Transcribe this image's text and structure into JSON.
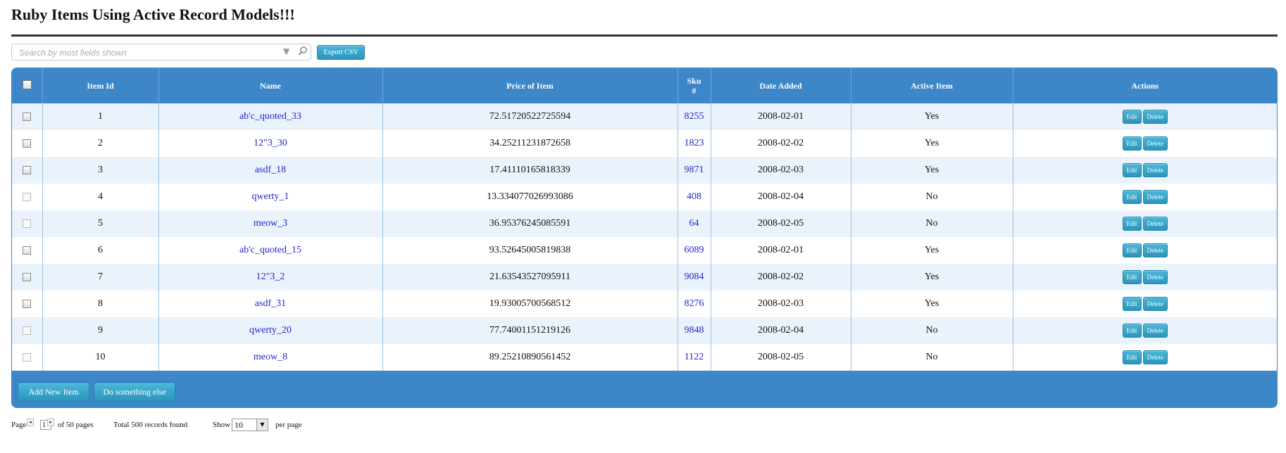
{
  "page": {
    "title": "Ruby Items Using Active Record Models!!!"
  },
  "search": {
    "placeholder": "Search by most fields shown",
    "dropdown_icon": "chevron-down-icon",
    "search_icon": "magnifier-icon"
  },
  "toolbar": {
    "export_label": "Export CSV"
  },
  "table": {
    "columns": [
      "Item Id",
      "Name",
      "Price of Item",
      "Sku #",
      "Date Added",
      "Active Item",
      "Actions"
    ],
    "sku_header_line1": "Sku",
    "sku_header_line2": "#",
    "action_labels": {
      "edit": "Edit",
      "delete": "Delete"
    },
    "rows": [
      {
        "id": "1",
        "name": "ab'c_quoted_33",
        "price": "72.51720522725594",
        "sku": "8255",
        "date": "2008-02-01",
        "active": "Yes",
        "checked_style": true
      },
      {
        "id": "2",
        "name": "12\"3_30",
        "price": "34.25211231872658",
        "sku": "1823",
        "date": "2008-02-02",
        "active": "Yes",
        "checked_style": true
      },
      {
        "id": "3",
        "name": "asdf_18",
        "price": "17.41110165818339",
        "sku": "9871",
        "date": "2008-02-03",
        "active": "Yes",
        "checked_style": true
      },
      {
        "id": "4",
        "name": "qwerty_1",
        "price": "13.334077026993086",
        "sku": "408",
        "date": "2008-02-04",
        "active": "No",
        "checked_style": false
      },
      {
        "id": "5",
        "name": "meow_3",
        "price": "36.95376245085591",
        "sku": "64",
        "date": "2008-02-05",
        "active": "No",
        "checked_style": false
      },
      {
        "id": "6",
        "name": "ab'c_quoted_15",
        "price": "93.52645005819838",
        "sku": "6089",
        "date": "2008-02-01",
        "active": "Yes",
        "checked_style": true
      },
      {
        "id": "7",
        "name": "12\"3_2",
        "price": "21.63543527095911",
        "sku": "9084",
        "date": "2008-02-02",
        "active": "Yes",
        "checked_style": true
      },
      {
        "id": "8",
        "name": "asdf_31",
        "price": "19.93005700568512",
        "sku": "8276",
        "date": "2008-02-03",
        "active": "Yes",
        "checked_style": true
      },
      {
        "id": "9",
        "name": "qwerty_20",
        "price": "77.74001151219126",
        "sku": "9848",
        "date": "2008-02-04",
        "active": "No",
        "checked_style": false
      },
      {
        "id": "10",
        "name": "meow_8",
        "price": "89.25210890561452",
        "sku": "1122",
        "date": "2008-02-05",
        "active": "No",
        "checked_style": false
      }
    ]
  },
  "footer": {
    "add_label": "Add New Item",
    "other_label": "Do something else"
  },
  "pager": {
    "page_label": "Page",
    "current_page": "1",
    "of_pages": "of 50 pages",
    "total": "Total 500 records found",
    "show_label": "Show",
    "per_page_value": "10",
    "per_page_label": "per page"
  },
  "colors": {
    "grid_header": "#3d87c8",
    "row_alt": "#eaf3fb",
    "link": "#2222cc",
    "button": "#2b95bd"
  }
}
